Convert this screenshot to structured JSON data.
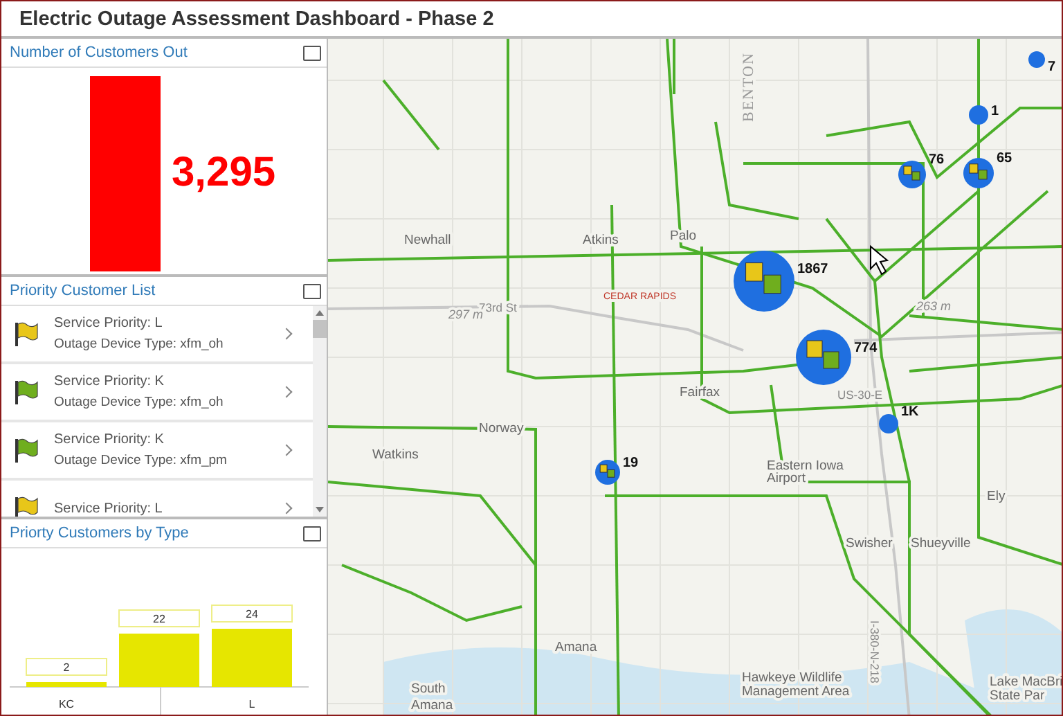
{
  "window": {
    "title": "Electric Outage Assessment Dashboard - Phase 2"
  },
  "customers_out": {
    "title": "Number of Customers Out",
    "value": "3,295"
  },
  "priority_list": {
    "title": "Priority Customer List",
    "items": [
      {
        "priority": "Service Priority: L",
        "device": "Outage Device Type: xfm_oh",
        "color": "#e8c619"
      },
      {
        "priority": "Service Priority: K",
        "device": "Outage Device Type: xfm_oh",
        "color": "#6fae1e"
      },
      {
        "priority": "Service Priority: K",
        "device": "Outage Device Type: xfm_pm",
        "color": "#6fae1e"
      },
      {
        "priority": "Service Priority: L",
        "color": "#e8c619"
      }
    ]
  },
  "by_type": {
    "title": "Priorty Customers by Type",
    "chart_data": {
      "type": "bar",
      "categories": [
        "KC",
        null,
        "L"
      ],
      "values": [
        2,
        22,
        24
      ],
      "data_labels": true
    }
  },
  "map": {
    "labels": [
      {
        "text": "Palo",
        "kind": "place"
      },
      {
        "text": "Newhall",
        "kind": "place"
      },
      {
        "text": "Atkins",
        "kind": "place"
      },
      {
        "text": "CEDAR RAPIDS",
        "kind": "county"
      },
      {
        "text": "73rd St",
        "kind": "road"
      },
      {
        "text": "297 m",
        "kind": "elev"
      },
      {
        "text": "263 m",
        "kind": "elev"
      },
      {
        "text": "BENTON",
        "kind": "boundary"
      },
      {
        "text": "Norway",
        "kind": "place"
      },
      {
        "text": "Watkins",
        "kind": "place"
      },
      {
        "text": "Fairfax",
        "kind": "place"
      },
      {
        "text": "Eastern Iowa",
        "kind": "place"
      },
      {
        "text": "Airport",
        "kind": "place"
      },
      {
        "text": "Swisher",
        "kind": "place"
      },
      {
        "text": "Shueyville",
        "kind": "place"
      },
      {
        "text": "Ely",
        "kind": "place"
      },
      {
        "text": "Amana",
        "kind": "place"
      },
      {
        "text": "South",
        "kind": "place"
      },
      {
        "text": "Amana",
        "kind": "place"
      },
      {
        "text": "Hawkeye Wildlife",
        "kind": "place"
      },
      {
        "text": "Management Area",
        "kind": "place"
      },
      {
        "text": "Lake MacBri",
        "kind": "place"
      },
      {
        "text": "State Par",
        "kind": "place"
      },
      {
        "text": "US-30-E",
        "kind": "road"
      },
      {
        "text": "I-380-N-218",
        "kind": "road"
      }
    ],
    "clusters": [
      {
        "count": "1867"
      },
      {
        "count": "774"
      },
      {
        "count": "76"
      },
      {
        "count": "65"
      },
      {
        "count": "19"
      },
      {
        "count": "1"
      },
      {
        "count": "7"
      },
      {
        "count": "1K"
      }
    ]
  }
}
